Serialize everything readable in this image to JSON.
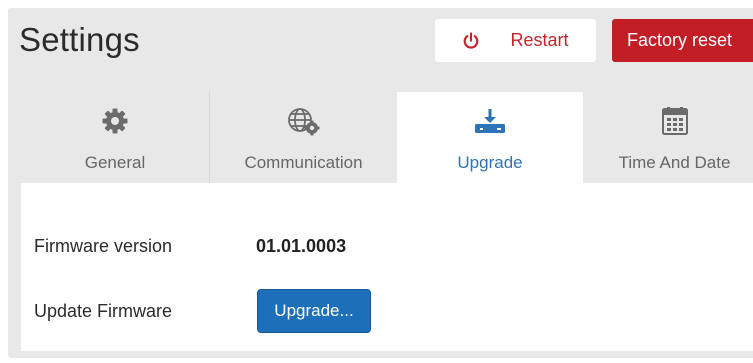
{
  "header": {
    "title": "Settings",
    "restart_label": "Restart",
    "factory_reset_label": "Factory reset"
  },
  "tabs": [
    {
      "label": "General",
      "icon": "gear-icon",
      "active": false
    },
    {
      "label": "Communication",
      "icon": "globe-gear-icon",
      "active": false
    },
    {
      "label": "Upgrade",
      "icon": "download-device-icon",
      "active": true
    },
    {
      "label": "Time And Date",
      "icon": "calendar-icon",
      "active": false
    }
  ],
  "upgrade": {
    "firmware_version_label": "Firmware version",
    "firmware_version_value": "01.01.0003",
    "update_firmware_label": "Update Firmware",
    "upgrade_button_label": "Upgrade..."
  },
  "colors": {
    "accent_blue": "#2d73b7",
    "danger_red": "#c11f25",
    "panel_gray": "#e8e8e8"
  }
}
